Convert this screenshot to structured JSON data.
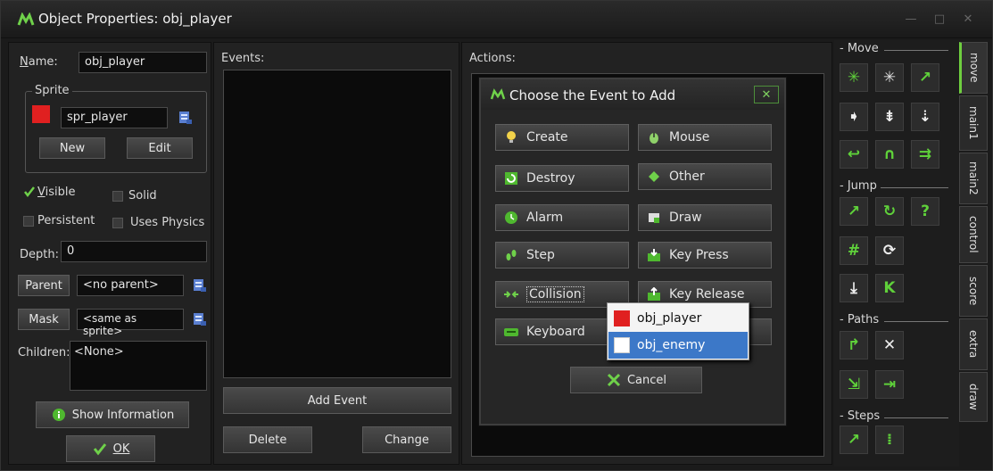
{
  "window": {
    "title": "Object Properties: obj_player",
    "minimize": "—",
    "maximize": "□",
    "close": "✕"
  },
  "left": {
    "name_label": "Name:",
    "name_value": "obj_player",
    "sprite_legend": "Sprite",
    "sprite_value": "spr_player",
    "sprite_color": "#e02020",
    "new_label": "New",
    "edit_label": "Edit",
    "visible_label": "Visible",
    "visible_checked": true,
    "solid_label": "Solid",
    "persistent_label": "Persistent",
    "uses_physics_label": "Uses Physics",
    "depth_label": "Depth:",
    "depth_value": "0",
    "parent_label": "Parent",
    "parent_value": "<no parent>",
    "mask_label": "Mask",
    "mask_value": "<same as sprite>",
    "children_label": "Children:",
    "children_value": "<None>",
    "show_info_label": "Show Information",
    "ok_label": "OK"
  },
  "events": {
    "label": "Events:",
    "add_event_label": "Add Event",
    "delete_label": "Delete",
    "change_label": "Change"
  },
  "actions": {
    "label": "Actions:"
  },
  "dialog": {
    "title": "Choose the Event to Add",
    "close": "✕",
    "buttons": [
      {
        "label": "Create",
        "icon": "lightbulb-icon"
      },
      {
        "label": "Mouse",
        "icon": "mouse-icon"
      },
      {
        "label": "Destroy",
        "icon": "destroy-icon"
      },
      {
        "label": "Other",
        "icon": "diamond-icon"
      },
      {
        "label": "Alarm",
        "icon": "clock-icon"
      },
      {
        "label": "Draw",
        "icon": "paint-icon"
      },
      {
        "label": "Step",
        "icon": "footsteps-icon"
      },
      {
        "label": "Key Press",
        "icon": "key-press-icon"
      },
      {
        "label": "Collision",
        "icon": "collision-arrows-icon"
      },
      {
        "label": "Key Release",
        "icon": "key-release-icon"
      },
      {
        "label": "Keyboard",
        "icon": "keyboard-icon"
      }
    ],
    "cancel_label": "Cancel",
    "popup": [
      {
        "label": "obj_player",
        "color": "#e02020"
      },
      {
        "label": "obj_enemy",
        "color": "#ffffff"
      }
    ],
    "popup_selected_color": "#3c78c8"
  },
  "toolbox": {
    "groups": [
      "Move",
      "Jump",
      "Paths",
      "Steps"
    ],
    "accent": "#5fd13a"
  },
  "tabs": [
    "move",
    "main1",
    "main2",
    "control",
    "score",
    "extra",
    "draw"
  ]
}
